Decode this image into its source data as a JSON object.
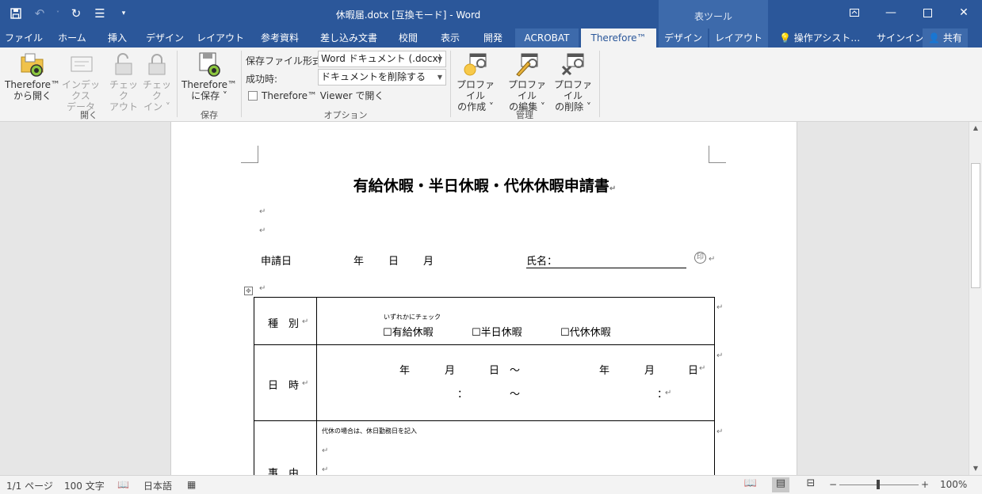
{
  "window": {
    "title": "休暇届.dotx [互換モード] - Word",
    "context_group": "表ツール"
  },
  "qat": {
    "save_icon": "save-icon",
    "undo_icon": "undo-icon",
    "redo_icon": "redo-icon",
    "touch_icon": "touch-mode-icon",
    "customize_icon": "customize-qat-icon"
  },
  "tabs": [
    {
      "label": "ファイル"
    },
    {
      "label": "ホーム"
    },
    {
      "label": "挿入"
    },
    {
      "label": "デザイン"
    },
    {
      "label": "レイアウト"
    },
    {
      "label": "参考資料"
    },
    {
      "label": "差し込み文書"
    },
    {
      "label": "校閲"
    },
    {
      "label": "表示"
    },
    {
      "label": "開発"
    },
    {
      "label": "ACROBAT"
    },
    {
      "label": "Therefore™"
    },
    {
      "label": "デザイン"
    },
    {
      "label": "レイアウト"
    }
  ],
  "tell_me": "操作アシスト…",
  "signin": "サインイン",
  "share": "共有",
  "ribbon": {
    "open_from": {
      "line1": "Therefore™",
      "line2": "から開く"
    },
    "index_data": {
      "line1": "インデックス",
      "line2": "データ"
    },
    "checkout": {
      "line1": "チェック",
      "line2": "アウト"
    },
    "checkin": {
      "line1": "チェック",
      "line2": "イン ˅"
    },
    "group_open": "開く",
    "save_to": {
      "line1": "Therefore™",
      "line2": "に保存 ˅"
    },
    "group_save": "保存",
    "save_format_label": "保存ファイル形式:",
    "save_format_value": "Word ドキュメント (.docx)",
    "on_success_label": "成功時:",
    "on_success_value": "ドキュメントを削除する",
    "viewer_checkbox": "Therefore™ Viewer で開く",
    "group_options": "オプション",
    "profile_create": {
      "line1": "プロファイル",
      "line2": "の作成 ˅"
    },
    "profile_edit": {
      "line1": "プロファイル",
      "line2": "の編集 ˅"
    },
    "profile_delete": {
      "line1": "プロファイル",
      "line2": "の削除 ˅"
    },
    "group_manage": "管理"
  },
  "document": {
    "heading": "有給休暇・半日休暇・代休休暇申請書",
    "apply_date": "申請日",
    "year": "年",
    "month": "月",
    "day": "日",
    "name_label": "氏名：",
    "seal": "印",
    "table": {
      "kind_label": "種　別",
      "kind_note": "いずれかにチェック",
      "kind_options": [
        "☐有給休暇",
        "☐半日休暇",
        "☐代休休暇"
      ],
      "datetime_label": "日　時",
      "date_row": [
        "年",
        "月",
        "日",
        "〜",
        "年",
        "月",
        "日"
      ],
      "time_sep": "：",
      "tilde": "〜",
      "reason_label": "事　由",
      "reason_note": "代休の場合は、休日勤務日を記入"
    }
  },
  "status": {
    "page": "1/1 ページ",
    "words": "100 文字",
    "language": "日本語",
    "zoom": "100%"
  }
}
